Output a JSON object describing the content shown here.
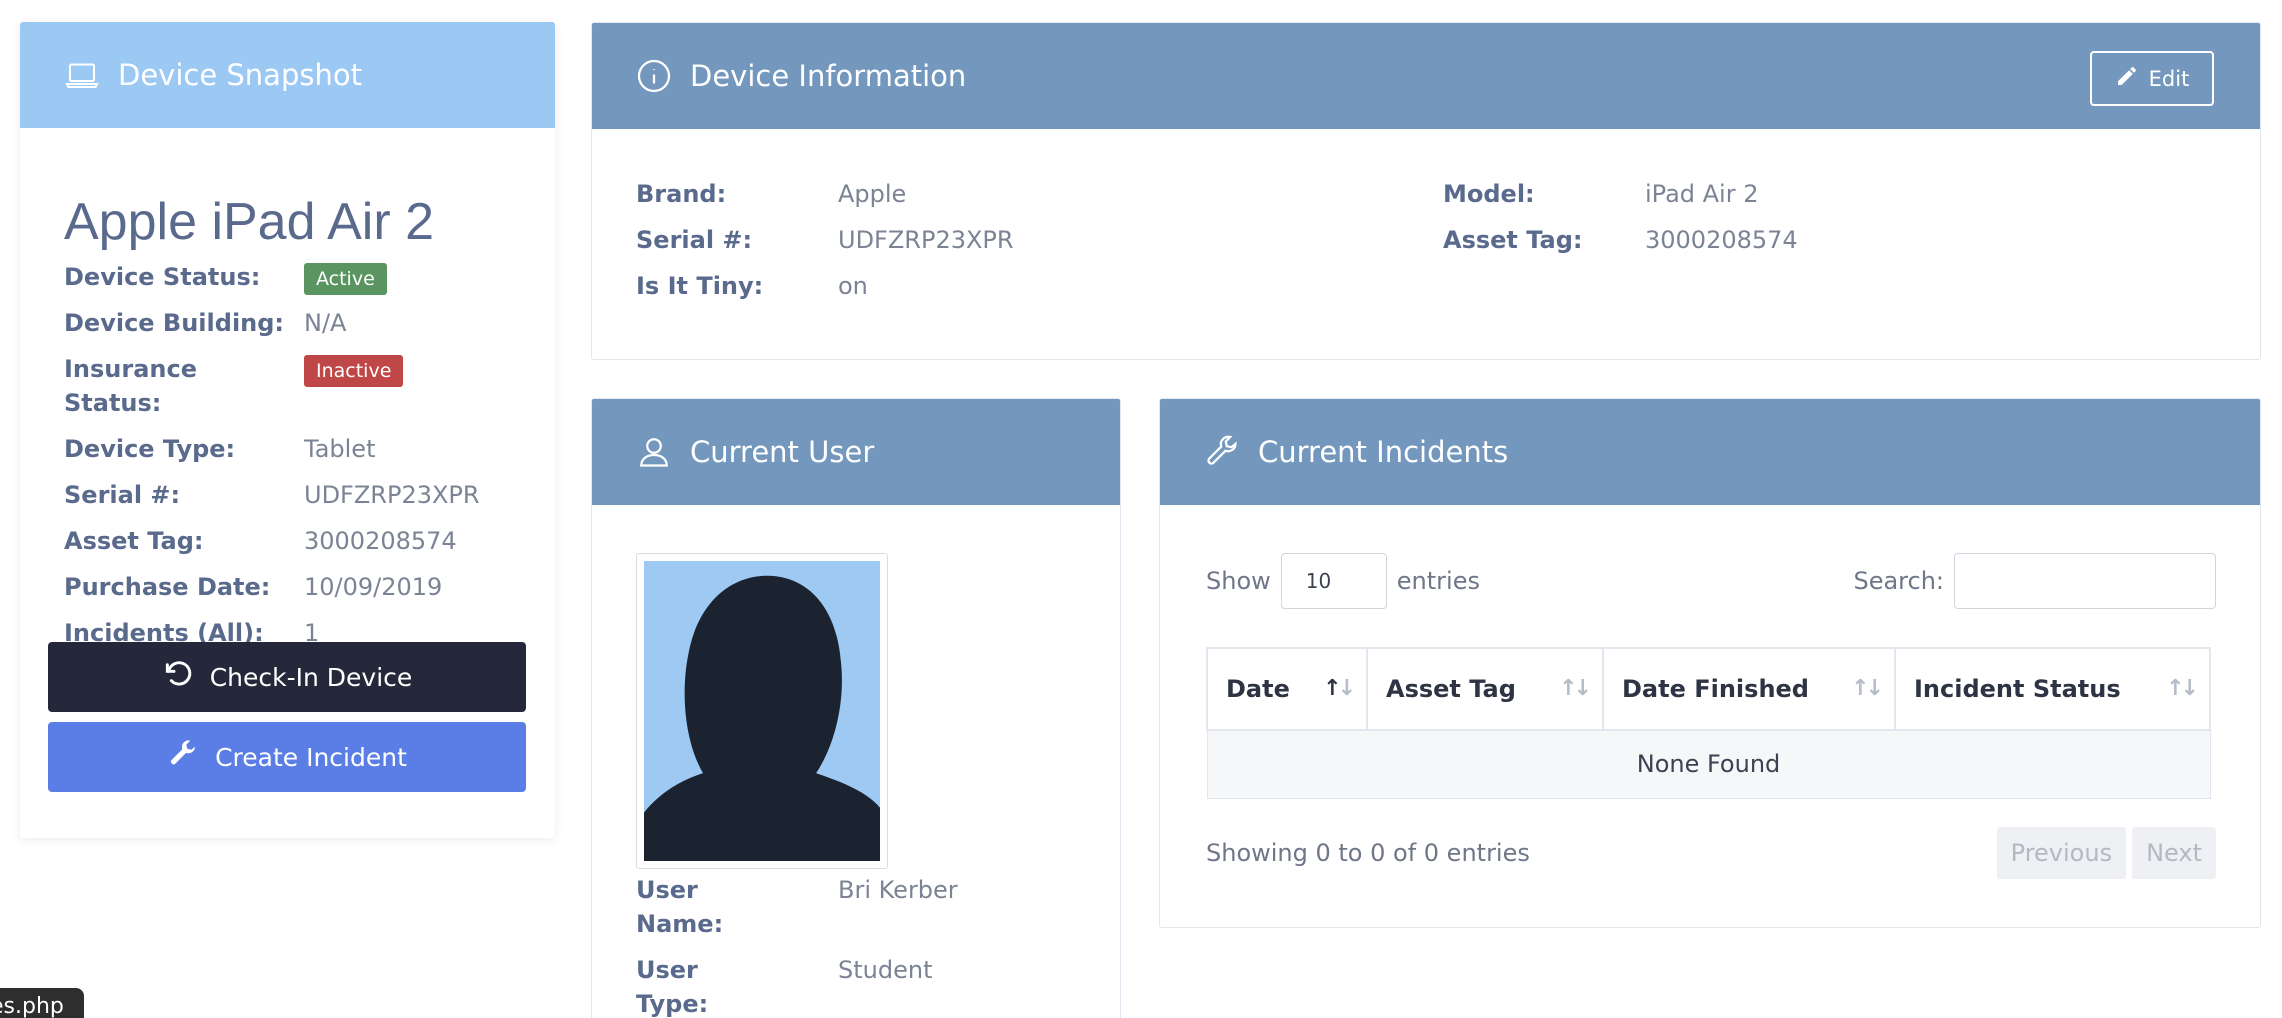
{
  "snapshot": {
    "header": "Device Snapshot",
    "device_name": "Apple iPad Air 2",
    "fields": [
      {
        "label": "Device Status:",
        "value": "Active"
      },
      {
        "label": "Device Building:",
        "value": "N/A"
      },
      {
        "label": "Insurance Status:",
        "value": "Inactive"
      },
      {
        "label": "Device Type:",
        "value": "Tablet"
      },
      {
        "label": "Serial #:",
        "value": "UDFZRP23XPR"
      },
      {
        "label": "Asset Tag:",
        "value": "3000208574"
      },
      {
        "label": "Purchase Date:",
        "value": "10/09/2019"
      },
      {
        "label": "Incidents (All):",
        "value": "1"
      }
    ],
    "checkin_label": "Check-In Device",
    "create_incident_label": "Create Incident"
  },
  "device_info": {
    "header": "Device Information",
    "edit_label": "Edit",
    "left": [
      {
        "label": "Brand:",
        "value": "Apple"
      },
      {
        "label": "Serial #:",
        "value": "UDFZRP23XPR"
      },
      {
        "label": "Is It Tiny:",
        "value": "on"
      }
    ],
    "right": [
      {
        "label": "Model:",
        "value": "iPad Air 2"
      },
      {
        "label": "Asset Tag:",
        "value": "3000208574"
      }
    ]
  },
  "current_user": {
    "header": "Current User",
    "fields": [
      {
        "label": "User Name:",
        "value": "Bri Kerber"
      },
      {
        "label": "User Type:",
        "value": "Student"
      }
    ]
  },
  "incidents": {
    "header": "Current Incidents",
    "show_label": "Show",
    "entries_value": "10",
    "entries_label": "entries",
    "search_label": "Search:",
    "columns": [
      "Date",
      "Asset Tag",
      "Date Finished",
      "Incident Status"
    ],
    "empty_text": "None Found",
    "info": "Showing 0 to 0 of 0 entries",
    "prev_label": "Previous",
    "next_label": "Next"
  },
  "tooltip": "es.php",
  "colors": {
    "header_blue": "#7397bd",
    "snapshot_header": "#9cc8f4",
    "active_green": "#5a9461",
    "inactive_red": "#c04747",
    "checkin_dark": "#25283b",
    "incident_blue": "#5a7ee6",
    "link_blue": "#4fa3d9"
  }
}
